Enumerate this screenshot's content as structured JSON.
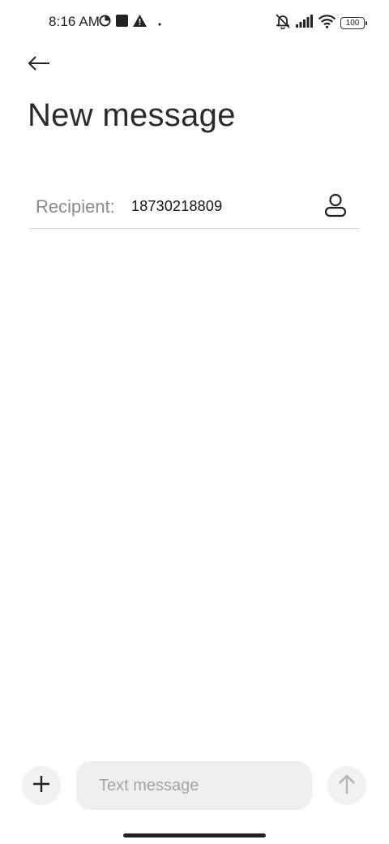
{
  "status_bar": {
    "time": "8:16 AM",
    "left_icons": [
      "data-saver-icon",
      "square-notification-icon",
      "warning-icon",
      "dot-icon"
    ],
    "right_icons": [
      "mute-icon",
      "signal-icon",
      "wifi-icon",
      "battery-icon"
    ],
    "battery_level": "100"
  },
  "header": {
    "back_icon": "arrow-left-icon",
    "title": "New message"
  },
  "recipient": {
    "label": "Recipient:",
    "value": "18730218809",
    "contact_icon": "person-icon"
  },
  "composer": {
    "add_icon": "plus-icon",
    "placeholder": "Text message",
    "send_icon": "arrow-up-icon"
  },
  "colors": {
    "background": "#ffffff",
    "button_bg": "#f1f1f1",
    "input_bg": "#efefef",
    "label_gray": "#8a8a8a"
  }
}
